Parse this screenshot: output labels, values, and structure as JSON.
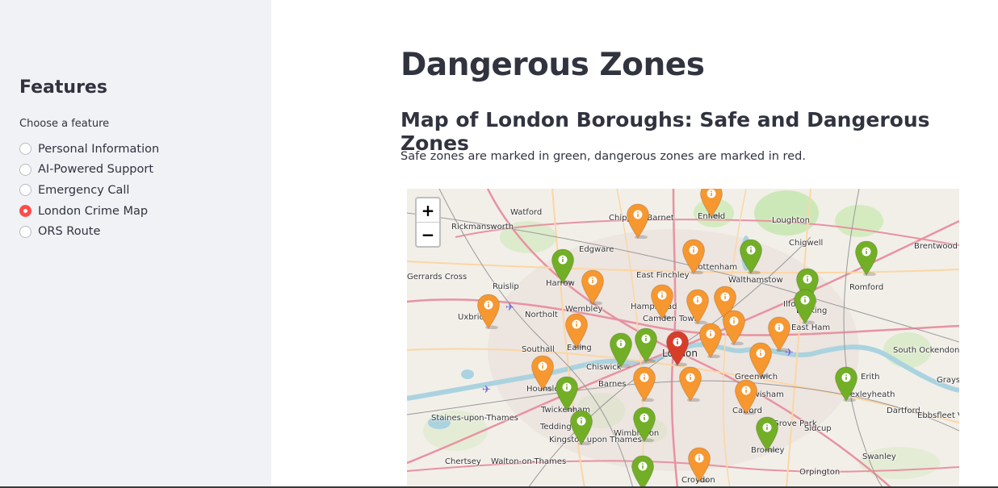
{
  "sidebar": {
    "heading": "Features",
    "radio_label": "Choose a feature",
    "options": [
      "Personal Information",
      "AI-Powered Support",
      "Emergency Call",
      "London Crime Map",
      "ORS Route"
    ],
    "selected": "London Crime Map"
  },
  "main": {
    "title": "Dangerous Zones",
    "subtitle": "Map of London Boroughs: Safe and Dangerous Zones",
    "description": "Safe zones are marked in green, dangerous zones are marked in red."
  },
  "map": {
    "zoom_in": "+",
    "zoom_out": "−",
    "colors": {
      "safe": "#72af26",
      "moderate": "#f69730",
      "dangerous": "#d63e2a",
      "accent": "#ff4b4b"
    },
    "place_labels": [
      "Watford",
      "Chipping Barnet",
      "Enfield",
      "Loughton",
      "Rickmansworth",
      "Edgware",
      "Chigwell",
      "Brentwood",
      "Gerrards Cross",
      "Harrow",
      "Tottenham",
      "Walthamstow",
      "East Finchley",
      "Ruislip",
      "Romford",
      "Wembley",
      "Hampstead",
      "Ilford",
      "Uxbridge",
      "Northolt",
      "Camden Town",
      "Ealing",
      "Southall",
      "London",
      "Barking",
      "East Ham",
      "South Ockendon",
      "Chiswick",
      "Greenwich",
      "Barnes",
      "Hounslow",
      "Erith",
      "Grays",
      "Twickenham",
      "Lewisham",
      "Bexleyheath",
      "Teddington",
      "Catford",
      "Dartford",
      "Ebbsfleet Valley",
      "Staines-upon-Thames",
      "Kingston upon Thames",
      "Wimbledon",
      "Grove Park",
      "Sidcup",
      "Bromley",
      "Swanley",
      "Chertsey",
      "Walton-on-Thames",
      "Croydon",
      "Orpington"
    ],
    "marker_icon": "info-icon"
  }
}
